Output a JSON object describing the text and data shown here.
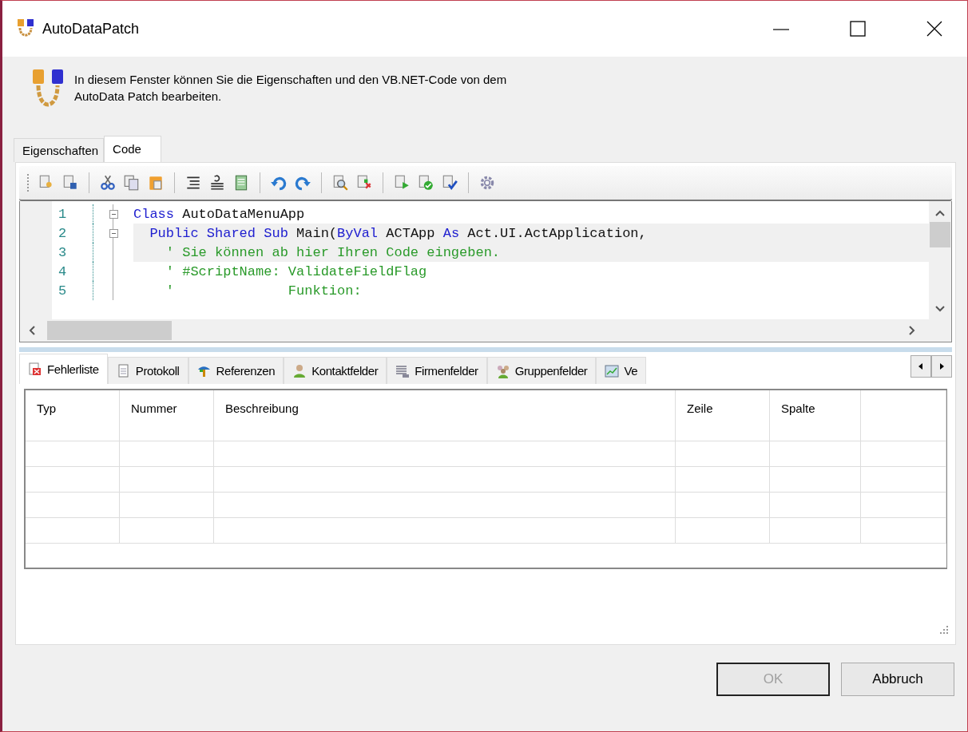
{
  "window": {
    "title": "AutoDataPatch"
  },
  "header": {
    "text": "In diesem Fenster können Sie die Eigenschaften und den VB.NET-Code von dem\nAutoData Patch bearbeiten."
  },
  "tabs": [
    {
      "label": "Eigenschaften",
      "selected": false
    },
    {
      "label": "Code",
      "selected": true
    }
  ],
  "editor": {
    "lines": [
      {
        "number": "1",
        "fold": true,
        "highlighted": false,
        "tokens": [
          {
            "kind": "keyword",
            "text": "Class"
          },
          {
            "kind": "plain",
            "text": " AutoDataMenuApp"
          }
        ]
      },
      {
        "number": "2",
        "fold": true,
        "highlighted": true,
        "tokens": [
          {
            "kind": "keyword",
            "text": "  Public Shared Sub"
          },
          {
            "kind": "plain",
            "text": " Main("
          },
          {
            "kind": "keyword",
            "text": "ByVal"
          },
          {
            "kind": "plain",
            "text": " ACTApp "
          },
          {
            "kind": "keyword",
            "text": "As"
          },
          {
            "kind": "plain",
            "text": " Act.UI.ActApplication,"
          }
        ]
      },
      {
        "number": "3",
        "fold": false,
        "highlighted": true,
        "tokens": [
          {
            "kind": "comment",
            "text": "    ' Sie können ab hier Ihren Code eingeben."
          }
        ]
      },
      {
        "number": "4",
        "fold": false,
        "highlighted": false,
        "tokens": [
          {
            "kind": "comment",
            "text": "    ' #ScriptName: ValidateFieldFlag"
          }
        ]
      },
      {
        "number": "5",
        "fold": false,
        "highlighted": false,
        "tokens": [
          {
            "kind": "comment",
            "text": "    '              Funktion:"
          }
        ]
      }
    ]
  },
  "bottom_tabs": [
    {
      "label": "Fehlerliste",
      "selected": true
    },
    {
      "label": "Protokoll",
      "selected": false
    },
    {
      "label": "Referenzen",
      "selected": false
    },
    {
      "label": "Kontaktfelder",
      "selected": false
    },
    {
      "label": "Firmenfelder",
      "selected": false
    },
    {
      "label": "Gruppenfelder",
      "selected": false
    },
    {
      "label": "Ve",
      "selected": false
    }
  ],
  "table": {
    "columns": [
      "Typ",
      "Nummer",
      "Beschreibung",
      "Zeile",
      "Spalte"
    ]
  },
  "buttons": [
    {
      "label": "OK",
      "disabled": true
    },
    {
      "label": "Abbruch",
      "disabled": false
    }
  ]
}
